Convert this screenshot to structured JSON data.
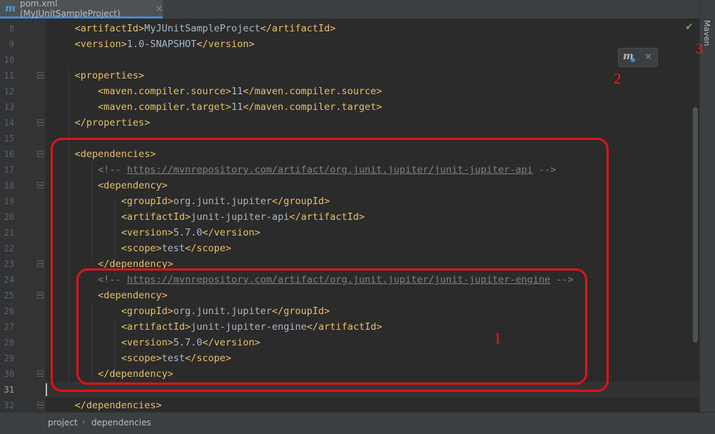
{
  "tab": {
    "icon": "m",
    "label": "pom.xml (MyJUnitSampleProject)",
    "close": "×"
  },
  "side_panel": {
    "label": "Maven",
    "status_icon": "✔"
  },
  "popup": {
    "icon": "maven-reload-icon",
    "icon_text": "m",
    "close": "×"
  },
  "annotations": {
    "a1": "1",
    "a2": "2",
    "a3": "3"
  },
  "breadcrumb": {
    "items": [
      "project",
      "dependencies"
    ],
    "separator": "›"
  },
  "colors": {
    "tag": "#e8bf6a",
    "text": "#a9b7c6",
    "comment": "#808080",
    "annotation": "#e0131a"
  },
  "editor": {
    "current_line": "31",
    "lines": [
      {
        "n": "8",
        "parts": [
          [
            "    ",
            "txt"
          ],
          [
            "<artifactId>",
            "tag"
          ],
          [
            "MyJUnitSampleProject",
            "txt"
          ],
          [
            "</artifactId>",
            "tag"
          ]
        ]
      },
      {
        "n": "9",
        "parts": [
          [
            "    ",
            "txt"
          ],
          [
            "<version>",
            "tag"
          ],
          [
            "1.0-SNAPSHOT",
            "txt"
          ],
          [
            "</version>",
            "tag"
          ]
        ]
      },
      {
        "n": "10",
        "parts": []
      },
      {
        "n": "11",
        "parts": [
          [
            "    ",
            "txt"
          ],
          [
            "<properties>",
            "tag"
          ]
        ]
      },
      {
        "n": "12",
        "parts": [
          [
            "        ",
            "txt"
          ],
          [
            "<maven.compiler.source>",
            "tag"
          ],
          [
            "11",
            "txt"
          ],
          [
            "</maven.compiler.source>",
            "tag"
          ]
        ]
      },
      {
        "n": "13",
        "parts": [
          [
            "        ",
            "txt"
          ],
          [
            "<maven.compiler.target>",
            "tag"
          ],
          [
            "11",
            "txt"
          ],
          [
            "</maven.compiler.target>",
            "tag"
          ]
        ]
      },
      {
        "n": "14",
        "parts": [
          [
            "    ",
            "txt"
          ],
          [
            "</properties>",
            "tag"
          ]
        ]
      },
      {
        "n": "15",
        "parts": []
      },
      {
        "n": "16",
        "parts": [
          [
            "    ",
            "txt"
          ],
          [
            "<dependencies>",
            "tag"
          ]
        ]
      },
      {
        "n": "17",
        "parts": [
          [
            "        ",
            "txt"
          ],
          [
            "<!-- ",
            "cmt"
          ],
          [
            "https://mvnrepository.com/artifact/org.junit.jupiter/junit-jupiter-api",
            "url"
          ],
          [
            " -->",
            "cmt"
          ]
        ]
      },
      {
        "n": "18",
        "parts": [
          [
            "        ",
            "txt"
          ],
          [
            "<dependency>",
            "tag"
          ]
        ]
      },
      {
        "n": "19",
        "parts": [
          [
            "            ",
            "txt"
          ],
          [
            "<groupId>",
            "tag"
          ],
          [
            "org.junit.jupiter",
            "txt"
          ],
          [
            "</groupId>",
            "tag"
          ]
        ]
      },
      {
        "n": "20",
        "parts": [
          [
            "            ",
            "txt"
          ],
          [
            "<artifactId>",
            "tag"
          ],
          [
            "junit-jupiter-api",
            "txt"
          ],
          [
            "</artifactId>",
            "tag"
          ]
        ]
      },
      {
        "n": "21",
        "parts": [
          [
            "            ",
            "txt"
          ],
          [
            "<version>",
            "tag"
          ],
          [
            "5.7.0",
            "txt"
          ],
          [
            "</version>",
            "tag"
          ]
        ]
      },
      {
        "n": "22",
        "parts": [
          [
            "            ",
            "txt"
          ],
          [
            "<scope>",
            "tag"
          ],
          [
            "test",
            "txt"
          ],
          [
            "</scope>",
            "tag"
          ]
        ]
      },
      {
        "n": "23",
        "parts": [
          [
            "        ",
            "txt"
          ],
          [
            "</dependency>",
            "tag"
          ]
        ]
      },
      {
        "n": "24",
        "parts": [
          [
            "        ",
            "txt"
          ],
          [
            "<!-- ",
            "cmt"
          ],
          [
            "https://mvnrepository.com/artifact/org.junit.jupiter/junit-jupiter-engine",
            "url"
          ],
          [
            " -->",
            "cmt"
          ]
        ]
      },
      {
        "n": "25",
        "parts": [
          [
            "        ",
            "txt"
          ],
          [
            "<dependency>",
            "tag"
          ]
        ]
      },
      {
        "n": "26",
        "parts": [
          [
            "            ",
            "txt"
          ],
          [
            "<groupId>",
            "tag"
          ],
          [
            "org.junit.jupiter",
            "txt"
          ],
          [
            "</groupId>",
            "tag"
          ]
        ]
      },
      {
        "n": "27",
        "parts": [
          [
            "            ",
            "txt"
          ],
          [
            "<artifactId>",
            "tag"
          ],
          [
            "junit-jupiter-engine",
            "txt"
          ],
          [
            "</artifactId>",
            "tag"
          ]
        ]
      },
      {
        "n": "28",
        "parts": [
          [
            "            ",
            "txt"
          ],
          [
            "<version>",
            "tag"
          ],
          [
            "5.7.0",
            "txt"
          ],
          [
            "</version>",
            "tag"
          ]
        ]
      },
      {
        "n": "29",
        "parts": [
          [
            "            ",
            "txt"
          ],
          [
            "<scope>",
            "tag"
          ],
          [
            "test",
            "txt"
          ],
          [
            "</scope>",
            "tag"
          ]
        ]
      },
      {
        "n": "30",
        "parts": [
          [
            "        ",
            "txt"
          ],
          [
            "</dependency>",
            "tag"
          ]
        ]
      },
      {
        "n": "31",
        "parts": []
      },
      {
        "n": "32",
        "parts": [
          [
            "    ",
            "txt"
          ],
          [
            "</dependencies>",
            "tag"
          ]
        ]
      }
    ]
  }
}
